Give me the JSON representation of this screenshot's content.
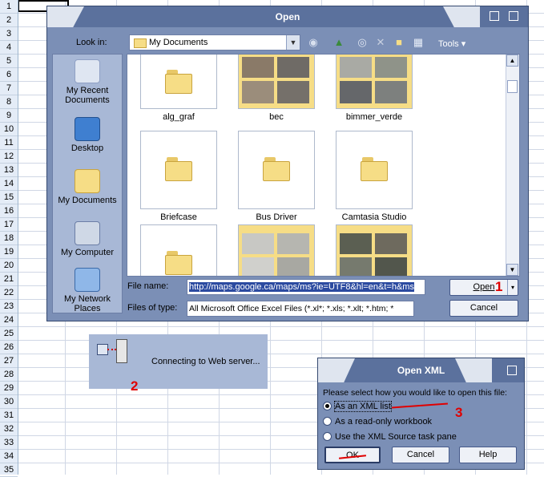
{
  "spreadsheet": {
    "row_numbers": [
      "1",
      "2",
      "3",
      "4",
      "5",
      "6",
      "7",
      "8",
      "9",
      "10",
      "11",
      "12",
      "13",
      "14",
      "15",
      "16",
      "17",
      "18",
      "19",
      "20",
      "21",
      "22",
      "23",
      "24",
      "25",
      "26",
      "27",
      "28",
      "29",
      "30",
      "31",
      "32",
      "33",
      "34",
      "35"
    ]
  },
  "open_dialog": {
    "title": "Open",
    "look_in_label": "Look in:",
    "look_in_value": "My Documents",
    "tools_label": "Tools",
    "places": [
      {
        "label": "My Recent Documents"
      },
      {
        "label": "Desktop"
      },
      {
        "label": "My Documents"
      },
      {
        "label": "My Computer"
      },
      {
        "label": "My Network Places"
      }
    ],
    "files": [
      {
        "name": "alg_graf",
        "kind": "folder"
      },
      {
        "name": "bec",
        "kind": "photos"
      },
      {
        "name": "bimmer_verde",
        "kind": "photos"
      },
      {
        "name": "Briefcase",
        "kind": "folder"
      },
      {
        "name": "Bus Driver",
        "kind": "folder"
      },
      {
        "name": "Camtasia Studio",
        "kind": "folder"
      },
      {
        "name": "",
        "kind": "folder"
      },
      {
        "name": "",
        "kind": "photos"
      },
      {
        "name": "",
        "kind": "photos"
      }
    ],
    "file_name_label": "File name:",
    "file_name_value": "http://maps.google.ca/maps/ms?ie=UTF8&hl=en&t=h&ms",
    "files_of_type_label": "Files of type:",
    "files_of_type_value": "All Microsoft Office Excel Files (*.xl*; *.xls; *.xlt; *.htm; *",
    "open_button": "Open",
    "cancel_button": "Cancel"
  },
  "progress": {
    "message": "Connecting to Web server..."
  },
  "open_xml_dialog": {
    "title": "Open XML",
    "prompt": "Please select how you would like to open this file:",
    "options": [
      "As an XML list",
      "As a read-only workbook",
      "Use the XML Source task pane"
    ],
    "selected": "As an XML list",
    "ok_button": "OK",
    "cancel_button": "Cancel",
    "help_button": "Help"
  },
  "annotations": [
    "1",
    "2",
    "3"
  ],
  "colors": {
    "accent": "#5b719d",
    "dialog_body": "#7b8fb6",
    "annotation": "#e00000"
  }
}
